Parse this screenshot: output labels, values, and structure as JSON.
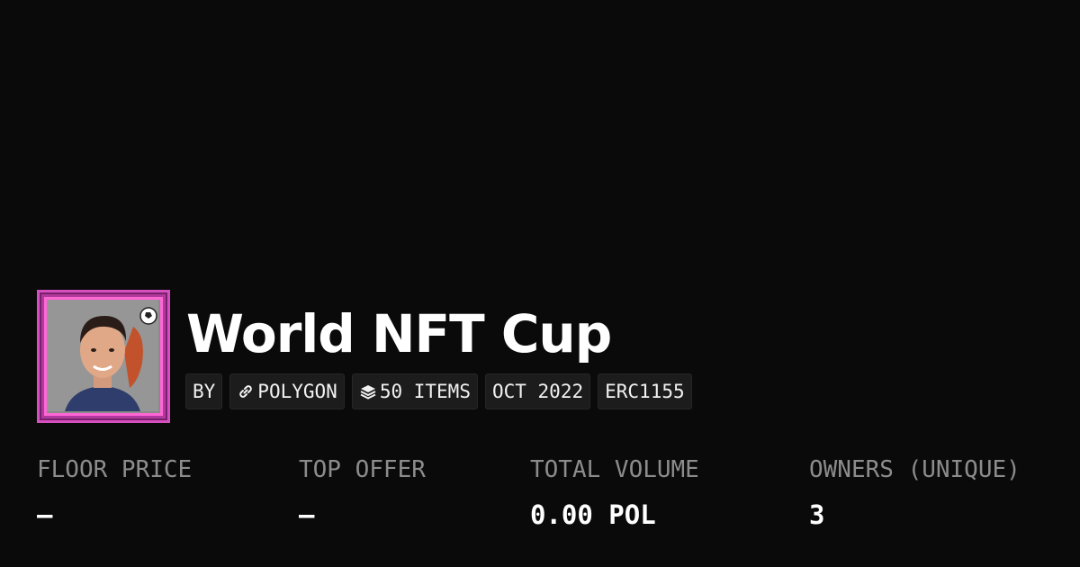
{
  "collection": {
    "title": "World NFT Cup",
    "avatar_icon": "player-portrait-image"
  },
  "chips": {
    "by": "BY",
    "chain": "POLYGON",
    "chain_icon": "polygon-link-icon",
    "items": "50 ITEMS",
    "items_icon": "layers-icon",
    "date": "OCT 2022",
    "standard": "ERC1155"
  },
  "stats": {
    "floor_price": {
      "label": "FLOOR PRICE",
      "value": "—"
    },
    "top_offer": {
      "label": "TOP OFFER",
      "value": "—"
    },
    "total_volume": {
      "label": "TOTAL VOLUME",
      "value": "0.00 POL"
    },
    "owners": {
      "label": "OWNERS (UNIQUE)",
      "value": "3"
    }
  },
  "colors": {
    "background": "#0a0a0a",
    "frame_pink": "#d64fbf",
    "chip_bg": "#1c1c1c",
    "label_gray": "#8c8c8c"
  }
}
